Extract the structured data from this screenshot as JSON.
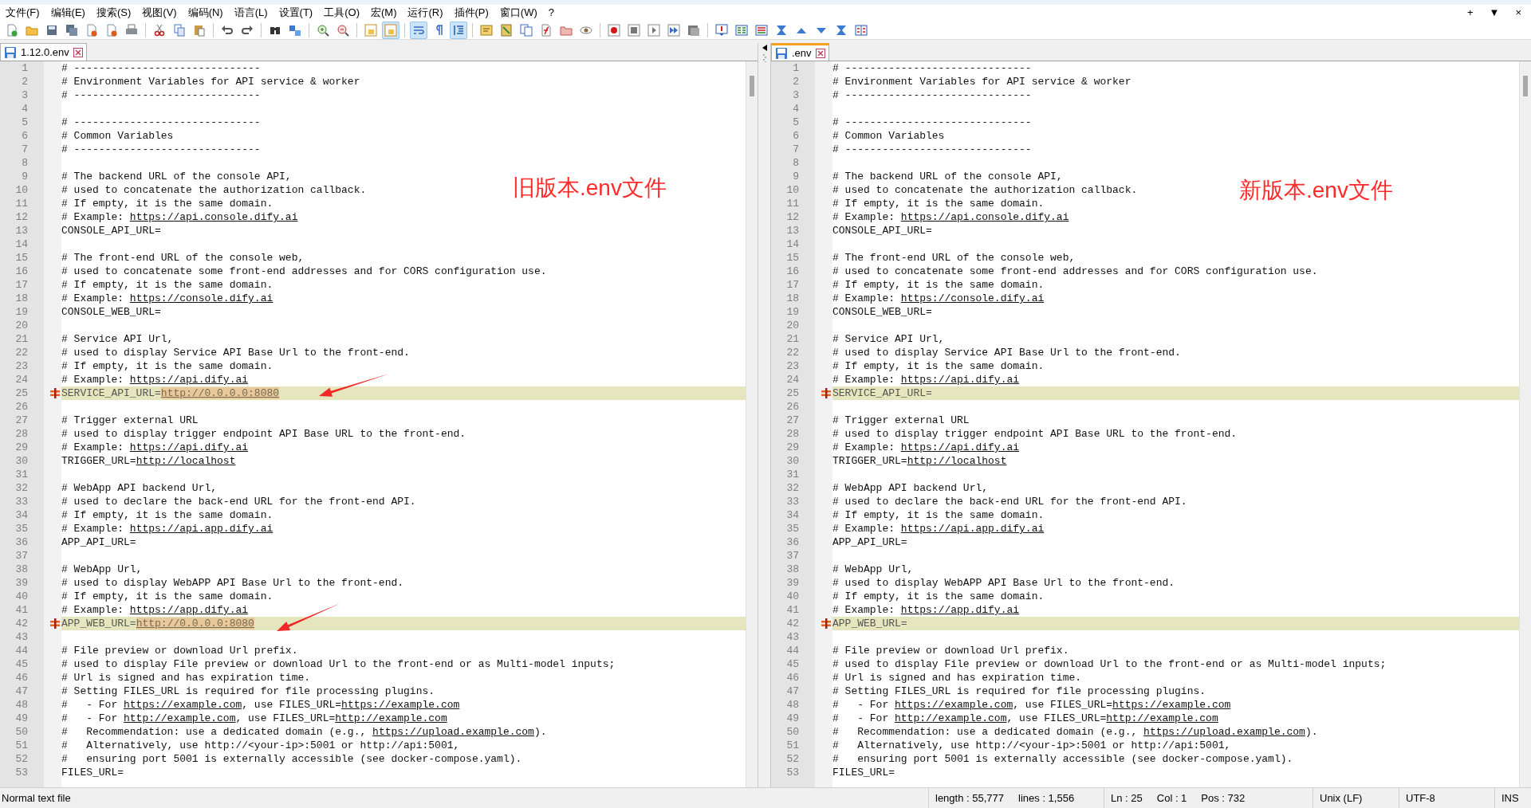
{
  "menu": [
    "文件(F)",
    "编辑(E)",
    "搜索(S)",
    "视图(V)",
    "编码(N)",
    "语言(L)",
    "设置(T)",
    "工具(O)",
    "宏(M)",
    "运行(R)",
    "插件(P)",
    "窗口(W)",
    "?"
  ],
  "window_controls": [
    "+",
    "▼",
    "×"
  ],
  "toolbar": [
    {
      "pressed": false
    },
    {
      "pressed": false
    },
    {
      "pressed": false
    },
    {
      "pressed": false
    },
    {
      "pressed": false
    },
    {
      "pressed": false
    },
    {
      "pressed": false
    },
    {
      "pressed": false
    },
    {
      "pressed": false
    },
    {
      "pressed": false
    },
    {
      "pressed": false
    },
    {
      "pressed": false
    },
    {
      "pressed": false
    },
    {
      "pressed": false
    },
    {
      "pressed": false
    },
    {
      "pressed": false
    },
    {
      "pressed": false
    },
    {
      "pressed": true
    },
    {
      "pressed": true
    },
    {
      "pressed": false
    },
    {
      "pressed": true
    },
    {
      "pressed": false
    },
    {
      "pressed": false
    },
    {
      "pressed": false
    },
    {
      "pressed": false
    },
    {
      "pressed": false
    },
    {
      "pressed": false
    },
    {
      "pressed": false
    },
    {
      "pressed": false
    },
    {
      "pressed": false
    },
    {
      "pressed": false
    },
    {
      "pressed": false
    },
    {
      "pressed": false
    },
    {
      "pressed": false
    },
    {
      "pressed": false
    },
    {
      "pressed": false
    },
    {
      "pressed": false
    },
    {
      "pressed": false
    },
    {
      "pressed": false
    },
    {
      "pressed": false
    }
  ],
  "panes": [
    {
      "tab": {
        "label": "1.12.0.env",
        "selected": true,
        "focused": false
      },
      "annotation": "旧版本.env文件",
      "lines": [
        {
          "number": "1",
          "changed": false,
          "segments": [
            {
              "text": "# ------------------------------",
              "kind": "plain"
            }
          ]
        },
        {
          "number": "2",
          "changed": false,
          "segments": [
            {
              "text": "# Environment Variables for API service & worker",
              "kind": "plain"
            }
          ]
        },
        {
          "number": "3",
          "changed": false,
          "segments": [
            {
              "text": "# ------------------------------",
              "kind": "plain"
            }
          ]
        },
        {
          "number": "4",
          "changed": false
        },
        {
          "number": "5",
          "changed": false,
          "segments": [
            {
              "text": "# ------------------------------",
              "kind": "plain"
            }
          ]
        },
        {
          "number": "6",
          "changed": false,
          "segments": [
            {
              "text": "# Common Variables",
              "kind": "plain"
            }
          ]
        },
        {
          "number": "7",
          "changed": false,
          "segments": [
            {
              "text": "# ------------------------------",
              "kind": "plain"
            }
          ]
        },
        {
          "number": "8",
          "changed": false
        },
        {
          "number": "9",
          "changed": false,
          "segments": [
            {
              "text": "# The backend URL of the console API,",
              "kind": "plain"
            }
          ]
        },
        {
          "number": "10",
          "changed": false,
          "segments": [
            {
              "text": "# used to concatenate the authorization callback.",
              "kind": "plain"
            }
          ]
        },
        {
          "number": "11",
          "changed": false,
          "segments": [
            {
              "text": "# If empty, it is the same domain.",
              "kind": "plain"
            }
          ]
        },
        {
          "number": "12",
          "changed": false,
          "segments": [
            {
              "text": "# Example: ",
              "kind": "plain"
            },
            {
              "text": "https://api.console.dify.ai",
              "kind": "link"
            }
          ]
        },
        {
          "number": "13",
          "changed": false,
          "segments": [
            {
              "text": "CONSOLE_API_URL=",
              "kind": "plain"
            }
          ]
        },
        {
          "number": "14",
          "changed": false
        },
        {
          "number": "15",
          "changed": false,
          "segments": [
            {
              "text": "# The front-end URL of the console web,",
              "kind": "plain"
            }
          ]
        },
        {
          "number": "16",
          "changed": false,
          "segments": [
            {
              "text": "# used to concatenate some front-end addresses and for CORS configuration use.",
              "kind": "plain"
            }
          ]
        },
        {
          "number": "17",
          "changed": false,
          "segments": [
            {
              "text": "# If empty, it is the same domain.",
              "kind": "plain"
            }
          ]
        },
        {
          "number": "18",
          "changed": false,
          "segments": [
            {
              "text": "# Example: ",
              "kind": "plain"
            },
            {
              "text": "https://console.dify.ai",
              "kind": "link"
            }
          ]
        },
        {
          "number": "19",
          "changed": false,
          "segments": [
            {
              "text": "CONSOLE_WEB_URL=",
              "kind": "plain"
            }
          ]
        },
        {
          "number": "20",
          "changed": false
        },
        {
          "number": "21",
          "changed": false,
          "segments": [
            {
              "text": "# Service API Url,",
              "kind": "plain"
            }
          ]
        },
        {
          "number": "22",
          "changed": false,
          "segments": [
            {
              "text": "# used to display Service API Base Url to the front-end.",
              "kind": "plain"
            }
          ]
        },
        {
          "number": "23",
          "changed": false,
          "segments": [
            {
              "text": "# If empty, it is the same domain.",
              "kind": "plain"
            }
          ]
        },
        {
          "number": "24",
          "changed": false,
          "segments": [
            {
              "text": "# Example: ",
              "kind": "plain"
            },
            {
              "text": "https://api.dify.ai",
              "kind": "link"
            }
          ]
        },
        {
          "number": "25",
          "changed": true,
          "segments": [
            {
              "text": "SERVICE_API_URL=",
              "kind": "plain"
            },
            {
              "text": "http://0.0.0.0:8080",
              "kind": "diff-link"
            }
          ]
        },
        {
          "number": "26",
          "changed": false
        },
        {
          "number": "27",
          "changed": false,
          "segments": [
            {
              "text": "# Trigger external URL",
              "kind": "plain"
            }
          ]
        },
        {
          "number": "28",
          "changed": false,
          "segments": [
            {
              "text": "# used to display trigger endpoint API Base URL to the front-end.",
              "kind": "plain"
            }
          ]
        },
        {
          "number": "29",
          "changed": false,
          "segments": [
            {
              "text": "# Example: ",
              "kind": "plain"
            },
            {
              "text": "https://api.dify.ai",
              "kind": "link"
            }
          ]
        },
        {
          "number": "30",
          "changed": false,
          "segments": [
            {
              "text": "TRIGGER_URL=",
              "kind": "plain"
            },
            {
              "text": "http://localhost",
              "kind": "link"
            }
          ]
        },
        {
          "number": "31",
          "changed": false
        },
        {
          "number": "32",
          "changed": false,
          "segments": [
            {
              "text": "# WebApp API backend Url,",
              "kind": "plain"
            }
          ]
        },
        {
          "number": "33",
          "changed": false,
          "segments": [
            {
              "text": "# used to declare the back-end URL for the front-end API.",
              "kind": "plain"
            }
          ]
        },
        {
          "number": "34",
          "changed": false,
          "segments": [
            {
              "text": "# If empty, it is the same domain.",
              "kind": "plain"
            }
          ]
        },
        {
          "number": "35",
          "changed": false,
          "segments": [
            {
              "text": "# Example: ",
              "kind": "plain"
            },
            {
              "text": "https://api.app.dify.ai",
              "kind": "link"
            }
          ]
        },
        {
          "number": "36",
          "changed": false,
          "segments": [
            {
              "text": "APP_API_URL=",
              "kind": "plain"
            }
          ]
        },
        {
          "number": "37",
          "changed": false
        },
        {
          "number": "38",
          "changed": false,
          "segments": [
            {
              "text": "# WebApp Url,",
              "kind": "plain"
            }
          ]
        },
        {
          "number": "39",
          "changed": false,
          "segments": [
            {
              "text": "# used to display WebAPP API Base Url to the front-end.",
              "kind": "plain"
            }
          ]
        },
        {
          "number": "40",
          "changed": false,
          "segments": [
            {
              "text": "# If empty, it is the same domain.",
              "kind": "plain"
            }
          ]
        },
        {
          "number": "41",
          "changed": false,
          "segments": [
            {
              "text": "# Example: ",
              "kind": "plain"
            },
            {
              "text": "https://app.dify.ai",
              "kind": "link"
            }
          ]
        },
        {
          "number": "42",
          "changed": true,
          "segments": [
            {
              "text": "APP_WEB_URL=",
              "kind": "plain"
            },
            {
              "text": "http://0.0.0.0:8080",
              "kind": "diff-link"
            }
          ]
        },
        {
          "number": "43",
          "changed": false
        },
        {
          "number": "44",
          "changed": false,
          "segments": [
            {
              "text": "# File preview or download Url prefix.",
              "kind": "plain"
            }
          ]
        },
        {
          "number": "45",
          "changed": false,
          "segments": [
            {
              "text": "# used to display File preview or download Url to the front-end or as Multi-model inputs;",
              "kind": "plain"
            }
          ]
        },
        {
          "number": "46",
          "changed": false,
          "segments": [
            {
              "text": "# Url is signed and has expiration time.",
              "kind": "plain"
            }
          ]
        },
        {
          "number": "47",
          "changed": false,
          "segments": [
            {
              "text": "# Setting FILES_URL is required for file processing plugins.",
              "kind": "plain"
            }
          ]
        },
        {
          "number": "48",
          "changed": false,
          "segments": [
            {
              "text": "#   - For ",
              "kind": "plain"
            },
            {
              "text": "https://example.com",
              "kind": "link"
            },
            {
              "text": ", use FILES_URL=",
              "kind": "plain"
            },
            {
              "text": "https://example.com",
              "kind": "link"
            }
          ]
        },
        {
          "number": "49",
          "changed": false,
          "segments": [
            {
              "text": "#   - For ",
              "kind": "plain"
            },
            {
              "text": "http://example.com",
              "kind": "link"
            },
            {
              "text": ", use FILES_URL=",
              "kind": "plain"
            },
            {
              "text": "http://example.com",
              "kind": "link"
            }
          ]
        },
        {
          "number": "50",
          "changed": false,
          "segments": [
            {
              "text": "#   Recommendation: use a dedicated domain (e.g., ",
              "kind": "plain"
            },
            {
              "text": "https://upload.example.com",
              "kind": "link"
            },
            {
              "text": ").",
              "kind": "plain"
            }
          ]
        },
        {
          "number": "51",
          "changed": false,
          "segments": [
            {
              "text": "#   Alternatively, use http://<your-ip>:5001 or http://api:5001,",
              "kind": "plain"
            }
          ]
        },
        {
          "number": "52",
          "changed": false,
          "segments": [
            {
              "text": "#   ensuring port 5001 is externally accessible (see docker-compose.yaml).",
              "kind": "plain"
            }
          ]
        },
        {
          "number": "53",
          "changed": false,
          "segments": [
            {
              "text": "FILES_URL=",
              "kind": "plain"
            }
          ]
        }
      ]
    },
    {
      "tab": {
        "label": ".env",
        "selected": true,
        "focused": true
      },
      "annotation": "新版本.env文件",
      "lines": [
        {
          "number": "1",
          "changed": false,
          "segments": [
            {
              "text": "# ------------------------------",
              "kind": "plain"
            }
          ]
        },
        {
          "number": "2",
          "changed": false,
          "segments": [
            {
              "text": "# Environment Variables for API service & worker",
              "kind": "plain"
            }
          ]
        },
        {
          "number": "3",
          "changed": false,
          "segments": [
            {
              "text": "# ------------------------------",
              "kind": "plain"
            }
          ]
        },
        {
          "number": "4",
          "changed": false
        },
        {
          "number": "5",
          "changed": false,
          "segments": [
            {
              "text": "# ------------------------------",
              "kind": "plain"
            }
          ]
        },
        {
          "number": "6",
          "changed": false,
          "segments": [
            {
              "text": "# Common Variables",
              "kind": "plain"
            }
          ]
        },
        {
          "number": "7",
          "changed": false,
          "segments": [
            {
              "text": "# ------------------------------",
              "kind": "plain"
            }
          ]
        },
        {
          "number": "8",
          "changed": false
        },
        {
          "number": "9",
          "changed": false,
          "segments": [
            {
              "text": "# The backend URL of the console API,",
              "kind": "plain"
            }
          ]
        },
        {
          "number": "10",
          "changed": false,
          "segments": [
            {
              "text": "# used to concatenate the authorization callback.",
              "kind": "plain"
            }
          ]
        },
        {
          "number": "11",
          "changed": false,
          "segments": [
            {
              "text": "# If empty, it is the same domain.",
              "kind": "plain"
            }
          ]
        },
        {
          "number": "12",
          "changed": false,
          "segments": [
            {
              "text": "# Example: ",
              "kind": "plain"
            },
            {
              "text": "https://api.console.dify.ai",
              "kind": "link"
            }
          ]
        },
        {
          "number": "13",
          "changed": false,
          "segments": [
            {
              "text": "CONSOLE_API_URL=",
              "kind": "plain"
            }
          ]
        },
        {
          "number": "14",
          "changed": false
        },
        {
          "number": "15",
          "changed": false,
          "segments": [
            {
              "text": "# The front-end URL of the console web,",
              "kind": "plain"
            }
          ]
        },
        {
          "number": "16",
          "changed": false,
          "segments": [
            {
              "text": "# used to concatenate some front-end addresses and for CORS configuration use.",
              "kind": "plain"
            }
          ]
        },
        {
          "number": "17",
          "changed": false,
          "segments": [
            {
              "text": "# If empty, it is the same domain.",
              "kind": "plain"
            }
          ]
        },
        {
          "number": "18",
          "changed": false,
          "segments": [
            {
              "text": "# Example: ",
              "kind": "plain"
            },
            {
              "text": "https://console.dify.ai",
              "kind": "link"
            }
          ]
        },
        {
          "number": "19",
          "changed": false,
          "segments": [
            {
              "text": "CONSOLE_WEB_URL=",
              "kind": "plain"
            }
          ]
        },
        {
          "number": "20",
          "changed": false
        },
        {
          "number": "21",
          "changed": false,
          "segments": [
            {
              "text": "# Service API Url,",
              "kind": "plain"
            }
          ]
        },
        {
          "number": "22",
          "changed": false,
          "segments": [
            {
              "text": "# used to display Service API Base Url to the front-end.",
              "kind": "plain"
            }
          ]
        },
        {
          "number": "23",
          "changed": false,
          "segments": [
            {
              "text": "# If empty, it is the same domain.",
              "kind": "plain"
            }
          ]
        },
        {
          "number": "24",
          "changed": false,
          "segments": [
            {
              "text": "# Example: ",
              "kind": "plain"
            },
            {
              "text": "https://api.dify.ai",
              "kind": "link"
            }
          ]
        },
        {
          "number": "25",
          "changed": true,
          "segments": [
            {
              "text": "SERVICE_API_URL=",
              "kind": "plain"
            }
          ]
        },
        {
          "number": "26",
          "changed": false
        },
        {
          "number": "27",
          "changed": false,
          "segments": [
            {
              "text": "# Trigger external URL",
              "kind": "plain"
            }
          ]
        },
        {
          "number": "28",
          "changed": false,
          "segments": [
            {
              "text": "# used to display trigger endpoint API Base URL to the front-end.",
              "kind": "plain"
            }
          ]
        },
        {
          "number": "29",
          "changed": false,
          "segments": [
            {
              "text": "# Example: ",
              "kind": "plain"
            },
            {
              "text": "https://api.dify.ai",
              "kind": "link"
            }
          ]
        },
        {
          "number": "30",
          "changed": false,
          "segments": [
            {
              "text": "TRIGGER_URL=",
              "kind": "plain"
            },
            {
              "text": "http://localhost",
              "kind": "link"
            }
          ]
        },
        {
          "number": "31",
          "changed": false
        },
        {
          "number": "32",
          "changed": false,
          "segments": [
            {
              "text": "# WebApp API backend Url,",
              "kind": "plain"
            }
          ]
        },
        {
          "number": "33",
          "changed": false,
          "segments": [
            {
              "text": "# used to declare the back-end URL for the front-end API.",
              "kind": "plain"
            }
          ]
        },
        {
          "number": "34",
          "changed": false,
          "segments": [
            {
              "text": "# If empty, it is the same domain.",
              "kind": "plain"
            }
          ]
        },
        {
          "number": "35",
          "changed": false,
          "segments": [
            {
              "text": "# Example: ",
              "kind": "plain"
            },
            {
              "text": "https://api.app.dify.ai",
              "kind": "link"
            }
          ]
        },
        {
          "number": "36",
          "changed": false,
          "segments": [
            {
              "text": "APP_API_URL=",
              "kind": "plain"
            }
          ]
        },
        {
          "number": "37",
          "changed": false
        },
        {
          "number": "38",
          "changed": false,
          "segments": [
            {
              "text": "# WebApp Url,",
              "kind": "plain"
            }
          ]
        },
        {
          "number": "39",
          "changed": false,
          "segments": [
            {
              "text": "# used to display WebAPP API Base Url to the front-end.",
              "kind": "plain"
            }
          ]
        },
        {
          "number": "40",
          "changed": false,
          "segments": [
            {
              "text": "# If empty, it is the same domain.",
              "kind": "plain"
            }
          ]
        },
        {
          "number": "41",
          "changed": false,
          "segments": [
            {
              "text": "# Example: ",
              "kind": "plain"
            },
            {
              "text": "https://app.dify.ai",
              "kind": "link"
            }
          ]
        },
        {
          "number": "42",
          "changed": true,
          "segments": [
            {
              "text": "APP_WEB_URL=",
              "kind": "plain"
            }
          ]
        },
        {
          "number": "43",
          "changed": false
        },
        {
          "number": "44",
          "changed": false,
          "segments": [
            {
              "text": "# File preview or download Url prefix.",
              "kind": "plain"
            }
          ]
        },
        {
          "number": "45",
          "changed": false,
          "segments": [
            {
              "text": "# used to display File preview or download Url to the front-end or as Multi-model inputs;",
              "kind": "plain"
            }
          ]
        },
        {
          "number": "46",
          "changed": false,
          "segments": [
            {
              "text": "# Url is signed and has expiration time.",
              "kind": "plain"
            }
          ]
        },
        {
          "number": "47",
          "changed": false,
          "segments": [
            {
              "text": "# Setting FILES_URL is required for file processing plugins.",
              "kind": "plain"
            }
          ]
        },
        {
          "number": "48",
          "changed": false,
          "segments": [
            {
              "text": "#   - For ",
              "kind": "plain"
            },
            {
              "text": "https://example.com",
              "kind": "link"
            },
            {
              "text": ", use FILES_URL=",
              "kind": "plain"
            },
            {
              "text": "https://example.com",
              "kind": "link"
            }
          ]
        },
        {
          "number": "49",
          "changed": false,
          "segments": [
            {
              "text": "#   - For ",
              "kind": "plain"
            },
            {
              "text": "http://example.com",
              "kind": "link"
            },
            {
              "text": ", use FILES_URL=",
              "kind": "plain"
            },
            {
              "text": "http://example.com",
              "kind": "link"
            }
          ]
        },
        {
          "number": "50",
          "changed": false,
          "segments": [
            {
              "text": "#   Recommendation: use a dedicated domain (e.g., ",
              "kind": "plain"
            },
            {
              "text": "https://upload.example.com",
              "kind": "link"
            },
            {
              "text": ").",
              "kind": "plain"
            }
          ]
        },
        {
          "number": "51",
          "changed": false,
          "segments": [
            {
              "text": "#   Alternatively, use http://<your-ip>:5001 or http://api:5001,",
              "kind": "plain"
            }
          ]
        },
        {
          "number": "52",
          "changed": false,
          "segments": [
            {
              "text": "#   ensuring port 5001 is externally accessible (see docker-compose.yaml).",
              "kind": "plain"
            }
          ]
        },
        {
          "number": "53",
          "changed": false,
          "segments": [
            {
              "text": "FILES_URL=",
              "kind": "plain"
            }
          ]
        }
      ]
    }
  ],
  "status_bar": {
    "file_type": "Normal text file",
    "length": "length : 55,777",
    "lines": "lines : 1,556",
    "line": "Ln : 25",
    "column": "Col : 1",
    "position": "Pos : 732",
    "eol": "Unix (LF)",
    "encoding": "UTF-8",
    "mode": "INS"
  }
}
